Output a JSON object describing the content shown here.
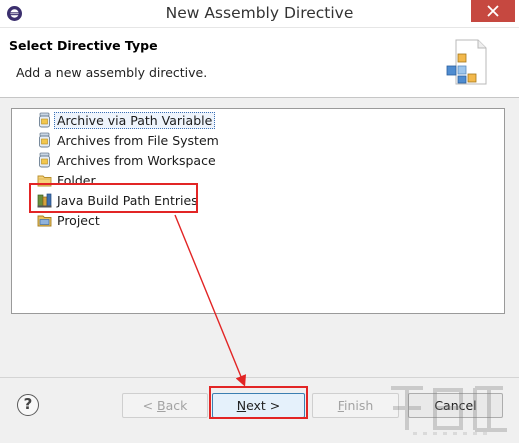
{
  "window": {
    "title": "New Assembly Directive"
  },
  "header": {
    "title": "Select Directive Type",
    "description": "Add a new assembly directive."
  },
  "tree": {
    "items": [
      {
        "label": "Archive via Path Variable",
        "icon": "jar-icon",
        "selected": true
      },
      {
        "label": "Archives from File System",
        "icon": "jar-icon",
        "selected": false
      },
      {
        "label": "Archives from Workspace",
        "icon": "jar-icon",
        "selected": false
      },
      {
        "label": "Folder",
        "icon": "folder-icon",
        "selected": false
      },
      {
        "label": "Java Build Path Entries",
        "icon": "java-library-icon",
        "selected": false
      },
      {
        "label": "Project",
        "icon": "project-icon",
        "selected": false
      }
    ]
  },
  "buttons": {
    "help": "?",
    "back_prefix": "< ",
    "back_mnemonic": "B",
    "back_rest": "ack",
    "next_mnemonic": "N",
    "next_rest": "ext >",
    "finish_mnemonic": "F",
    "finish_rest": "inish",
    "cancel": "Cancel"
  },
  "colors": {
    "annotation": "#e22525",
    "close_button": "#c64840",
    "selection_border": "#3a6fb5"
  }
}
